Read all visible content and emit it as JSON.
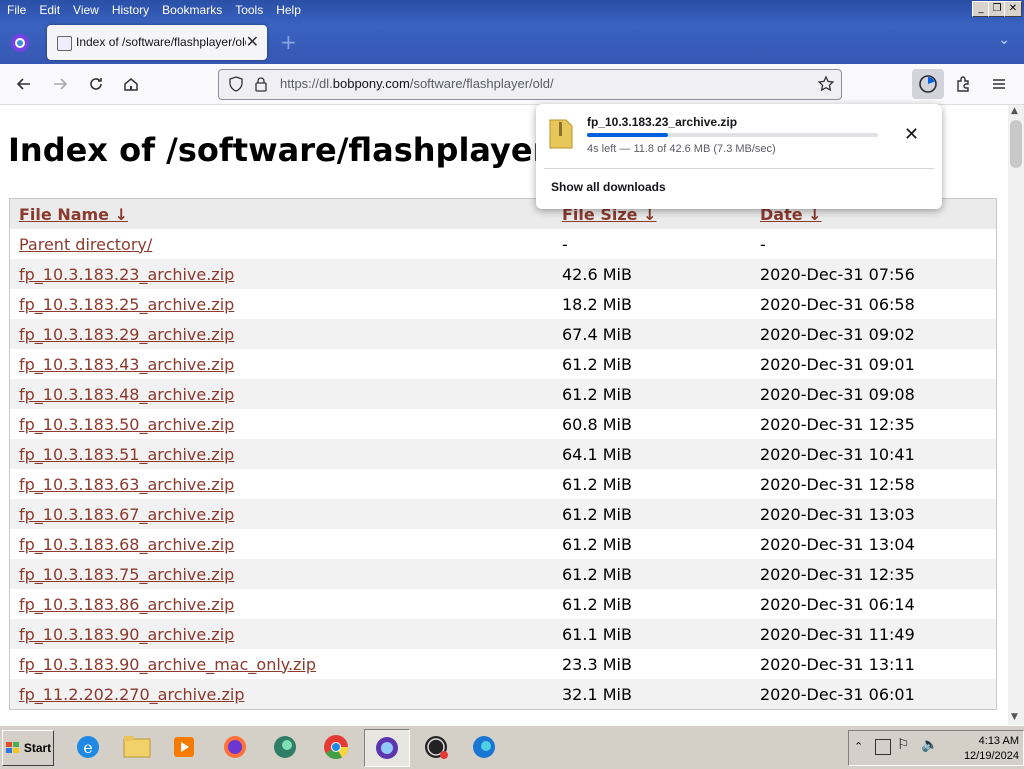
{
  "menu": [
    "File",
    "Edit",
    "View",
    "History",
    "Bookmarks",
    "Tools",
    "Help"
  ],
  "tab": {
    "title": "Index of /software/flashplayer/old/"
  },
  "urlbar": {
    "host_prefix": "https://dl.",
    "host": "bobpony.com",
    "path": "/software/flashplayer/old/"
  },
  "page": {
    "title": "Index of /software/flashplayer/old/",
    "headers": {
      "name": "File Name  ↓",
      "size": "File Size  ↓",
      "date": "Date  ↓"
    },
    "rows": [
      {
        "name": "Parent directory/",
        "size": "-",
        "date": "-"
      },
      {
        "name": "fp_10.3.183.23_archive.zip",
        "size": "42.6 MiB",
        "date": "2020-Dec-31 07:56"
      },
      {
        "name": "fp_10.3.183.25_archive.zip",
        "size": "18.2 MiB",
        "date": "2020-Dec-31 06:58"
      },
      {
        "name": "fp_10.3.183.29_archive.zip",
        "size": "67.4 MiB",
        "date": "2020-Dec-31 09:02"
      },
      {
        "name": "fp_10.3.183.43_archive.zip",
        "size": "61.2 MiB",
        "date": "2020-Dec-31 09:01"
      },
      {
        "name": "fp_10.3.183.48_archive.zip",
        "size": "61.2 MiB",
        "date": "2020-Dec-31 09:08"
      },
      {
        "name": "fp_10.3.183.50_archive.zip",
        "size": "60.8 MiB",
        "date": "2020-Dec-31 12:35"
      },
      {
        "name": "fp_10.3.183.51_archive.zip",
        "size": "64.1 MiB",
        "date": "2020-Dec-31 10:41"
      },
      {
        "name": "fp_10.3.183.63_archive.zip",
        "size": "61.2 MiB",
        "date": "2020-Dec-31 12:58"
      },
      {
        "name": "fp_10.3.183.67_archive.zip",
        "size": "61.2 MiB",
        "date": "2020-Dec-31 13:03"
      },
      {
        "name": "fp_10.3.183.68_archive.zip",
        "size": "61.2 MiB",
        "date": "2020-Dec-31 13:04"
      },
      {
        "name": "fp_10.3.183.75_archive.zip",
        "size": "61.2 MiB",
        "date": "2020-Dec-31 12:35"
      },
      {
        "name": "fp_10.3.183.86_archive.zip",
        "size": "61.2 MiB",
        "date": "2020-Dec-31 06:14"
      },
      {
        "name": "fp_10.3.183.90_archive.zip",
        "size": "61.1 MiB",
        "date": "2020-Dec-31 11:49"
      },
      {
        "name": "fp_10.3.183.90_archive_mac_only.zip",
        "size": "23.3 MiB",
        "date": "2020-Dec-31 13:11"
      },
      {
        "name": "fp_11.2.202.270_archive.zip",
        "size": "32.1 MiB",
        "date": "2020-Dec-31 06:01"
      }
    ]
  },
  "downloads": {
    "file_name": "fp_10.3.183.23_archive.zip",
    "progress": 0.277,
    "status": "4s left — 11.8 of 42.6 MB (7.3 MB/sec)",
    "show_all": "Show all downloads"
  },
  "taskbar": {
    "start_label": "Start",
    "apps": [
      "internet-explorer-icon",
      "file-explorer-icon",
      "media-player-icon",
      "firefox-icon",
      "edge-beta-icon",
      "chrome-icon",
      "firefox-nightly-icon",
      "obs-icon",
      "edge-icon"
    ],
    "clock_time": "4:13 AM",
    "clock_date": "12/19/2024"
  },
  "colors": {
    "link": "#8b3a2e",
    "titlebar": "#3558b3",
    "accent": "#0061e0"
  }
}
